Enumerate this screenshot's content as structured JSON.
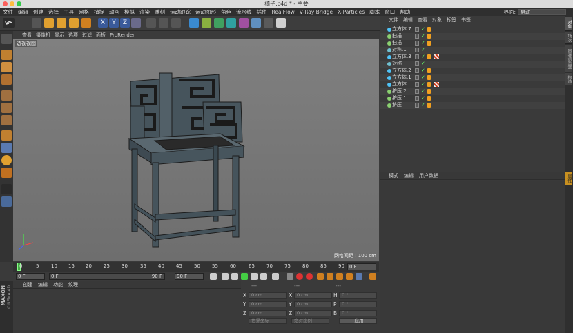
{
  "window": {
    "title": "椅子.c4d * - 主要"
  },
  "menubar": {
    "items": [
      "文件",
      "编辑",
      "创建",
      "选择",
      "工具",
      "网格",
      "捕捉",
      "动画",
      "模拟",
      "渲染",
      "雕刻",
      "运动跟踪",
      "运动图形",
      "角色",
      "流水线",
      "插件",
      "RealFlow",
      "V-Ray Bridge",
      "X-Particles",
      "脚本",
      "窗口",
      "帮助"
    ],
    "layout_label": "界面:",
    "layout_value": "启动"
  },
  "viewport": {
    "menu": [
      "查看",
      "摄像机",
      "显示",
      "选项",
      "过滤",
      "面板",
      "ProRender"
    ],
    "view_name": "透视视图",
    "grid_label": "网格间距 : 100 cm"
  },
  "timeline": {
    "ticks": [
      "0",
      "5",
      "10",
      "15",
      "20",
      "25",
      "30",
      "35",
      "40",
      "45",
      "50",
      "55",
      "60",
      "65",
      "70",
      "75",
      "80",
      "85",
      "90"
    ],
    "current_frame": "0 F"
  },
  "transport": {
    "start": "0 F",
    "preview_start": "0 F",
    "preview_end": "90 F",
    "end": "90 F"
  },
  "materials": {
    "menu": [
      "创建",
      "编辑",
      "功能",
      "纹理"
    ]
  },
  "maxon": {
    "brand": "MAXON",
    "product": "CINEMA 4D"
  },
  "coords": {
    "headers": [
      "---",
      "---",
      "---"
    ],
    "rows": [
      {
        "a": "X",
        "av": "0 cm",
        "b": "X",
        "bv": "0 cm",
        "c": "H",
        "cv": "0 °"
      },
      {
        "a": "Y",
        "av": "0 cm",
        "b": "Y",
        "bv": "0 cm",
        "c": "P",
        "cv": "0 °"
      },
      {
        "a": "Z",
        "av": "0 cm",
        "b": "Z",
        "bv": "0 cm",
        "c": "B",
        "cv": "0 °"
      }
    ],
    "mode": "世界坐标",
    "scale": "绝对比例",
    "apply": "应用"
  },
  "objects": {
    "menu": [
      "文件",
      "编辑",
      "查看",
      "对象",
      "标签",
      "书签"
    ],
    "list": [
      {
        "name": "立方体.7",
        "tag2": false
      },
      {
        "name": "扫描.1",
        "tag2": false
      },
      {
        "name": "扫描",
        "tag2": false
      },
      {
        "name": "对称.1",
        "tag2": false
      },
      {
        "name": "立方体.3",
        "tag2": true
      },
      {
        "name": "对称",
        "tag2": false
      },
      {
        "name": "立方体.2",
        "tag2": false
      },
      {
        "name": "立方体.1",
        "tag2": false
      },
      {
        "name": "立方体",
        "tag2": true
      },
      {
        "name": "挤压.2",
        "tag2": false
      },
      {
        "name": "挤压.1",
        "tag2": false
      },
      {
        "name": "挤压",
        "tag2": false
      }
    ]
  },
  "attributes": {
    "menu": [
      "模式",
      "编辑",
      "用户数据"
    ]
  },
  "sidetabs": {
    "top": [
      "对象",
      "场次",
      "内容浏览器",
      "构造"
    ],
    "bottom": [
      "属性"
    ]
  },
  "colors": {
    "accent": "#f0a020",
    "object_icon": "#4fc3f7",
    "viewport_bg": "#777777"
  }
}
